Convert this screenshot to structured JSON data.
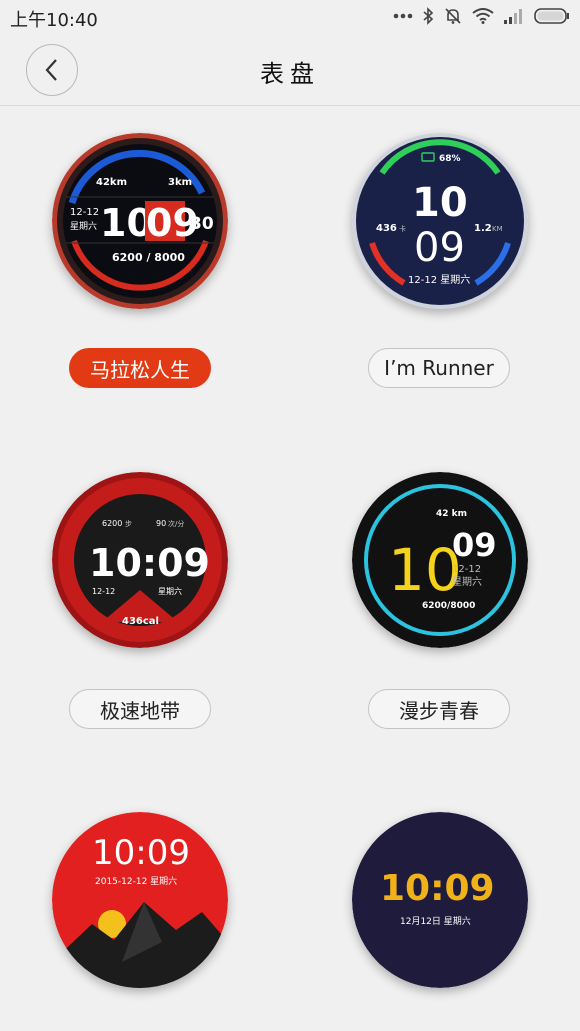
{
  "status_bar": {
    "time": "上午10:40",
    "icons": [
      "more-dots-icon",
      "bluetooth-icon",
      "mute-icon",
      "wifi-icon",
      "signal-icon",
      "battery-icon"
    ]
  },
  "header": {
    "back_icon": "chevron-left-icon",
    "title": "表盘"
  },
  "colors": {
    "accent": "#e23a14",
    "background": "#f0f0f0"
  },
  "watch_faces": [
    {
      "label": "马拉松人生",
      "selected": true,
      "display": {
        "distance_left": "42km",
        "distance_right": "3km",
        "date": "12-12",
        "weekday": "星期六",
        "hour": "10",
        "minute": "09",
        "second": "30",
        "steps": "6200 / 8000"
      }
    },
    {
      "label": "I’m Runner",
      "selected": false,
      "display": {
        "battery": "68%",
        "hour": "10",
        "minute": "09",
        "calories": "436",
        "calorie_unit": "卡",
        "distance": "1.2",
        "distance_unit": "KM",
        "date": "12-12 星期六"
      }
    },
    {
      "label": "极速地带",
      "selected": false,
      "display": {
        "steps": "6200",
        "steps_unit": "步",
        "heart_rate": "90",
        "heart_rate_unit": "次/分",
        "time": "10:09",
        "date": "12-12",
        "weekday": "星期六",
        "calories": "436cal"
      }
    },
    {
      "label": "漫步青春",
      "selected": false,
      "display": {
        "distance": "42 km",
        "hour": "10",
        "minute": "09",
        "date": "12-12",
        "weekday": "星期六",
        "steps": "6200/8000"
      }
    },
    {
      "label": "",
      "selected": false,
      "display": {
        "time": "10:09",
        "date": "2015-12-12 星期六"
      }
    },
    {
      "label": "",
      "selected": false,
      "display": {
        "time": "10:09",
        "date": "12月12日 星期六"
      }
    }
  ]
}
